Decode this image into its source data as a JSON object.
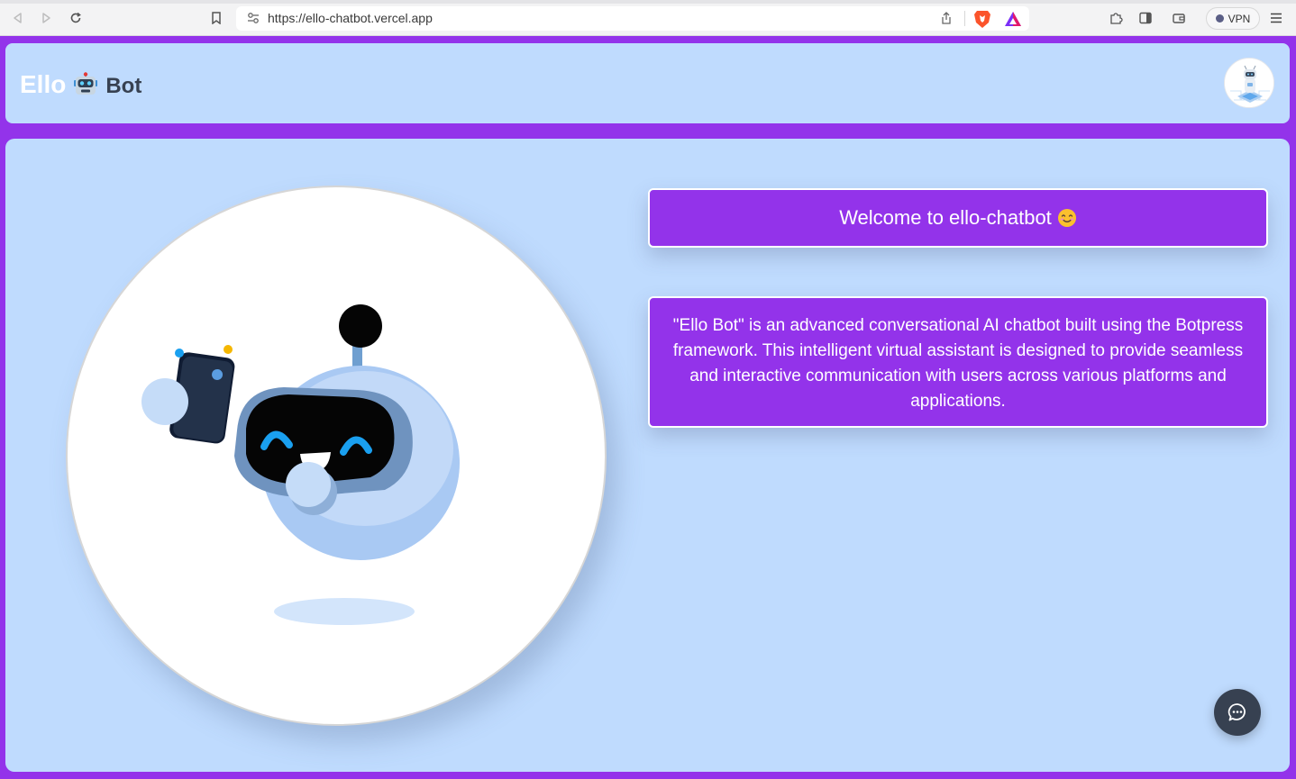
{
  "browser": {
    "url": "https://ello-chatbot.vercel.app",
    "vpn_label": "VPN"
  },
  "header": {
    "logo_primary": "Ello",
    "logo_secondary": "Bot",
    "logo_emoji": "robot-emoji"
  },
  "welcome": {
    "title": "Welcome to ello-chatbot",
    "title_emoji": "smiling-face-emoji"
  },
  "description": {
    "text": "\"Ello Bot\" is an advanced conversational AI chatbot built using the Botpress framework. This intelligent virtual assistant is designed to provide seamless and interactive communication with users across various platforms and applications."
  },
  "chat_widget": {
    "icon": "chat-bubble-icon"
  },
  "colors": {
    "page_border": "#9333ea",
    "panel_bg": "#bfdbfe",
    "card_bg": "#9333ea",
    "fab_bg": "#374151"
  }
}
